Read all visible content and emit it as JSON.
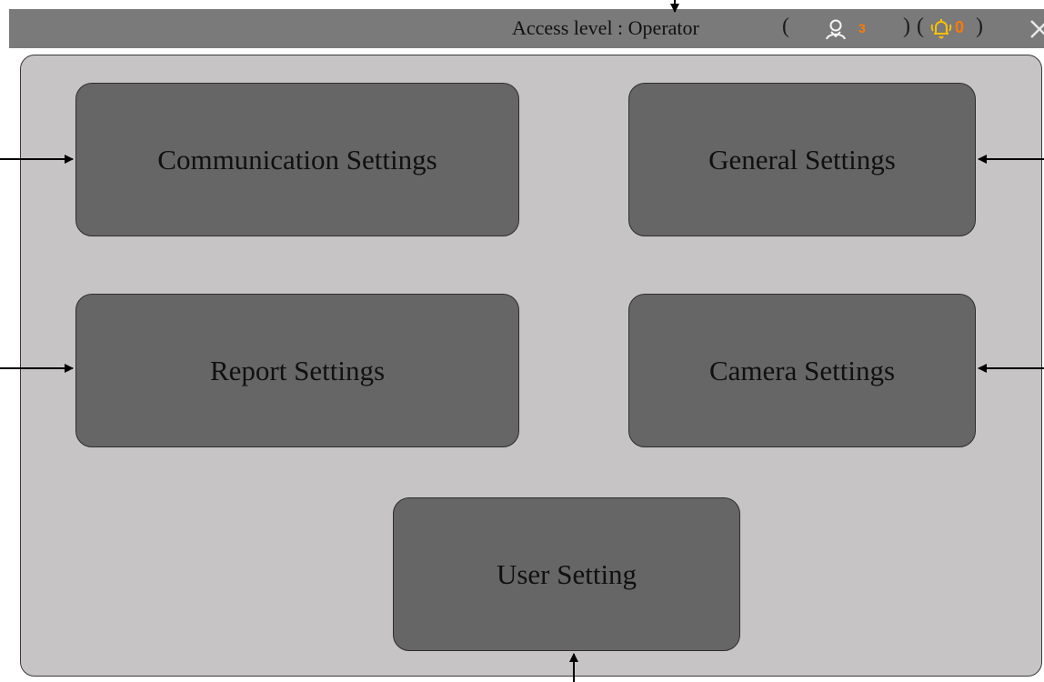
{
  "header": {
    "access_level_text": "Access level : Operator",
    "paren_open_1": "(",
    "paren_close_1": ")",
    "paren_open_2": "(",
    "paren_close_2": ")",
    "user_icon": "user-icon",
    "user_count": "3",
    "alarm_icon": "alarm-bell-icon",
    "alarm_count": "0",
    "close_icon": "close-icon",
    "colors": {
      "bar": "#7a7a7a",
      "count_accent": "#ff7a00"
    }
  },
  "settings_menu": {
    "tiles": [
      {
        "label": "Communication Settings"
      },
      {
        "label": "General Settings"
      },
      {
        "label": "Report Settings"
      },
      {
        "label": "Camera Settings"
      },
      {
        "label": "User Setting"
      }
    ],
    "colors": {
      "panel": "#c6c4c5",
      "tile": "#666666"
    }
  }
}
